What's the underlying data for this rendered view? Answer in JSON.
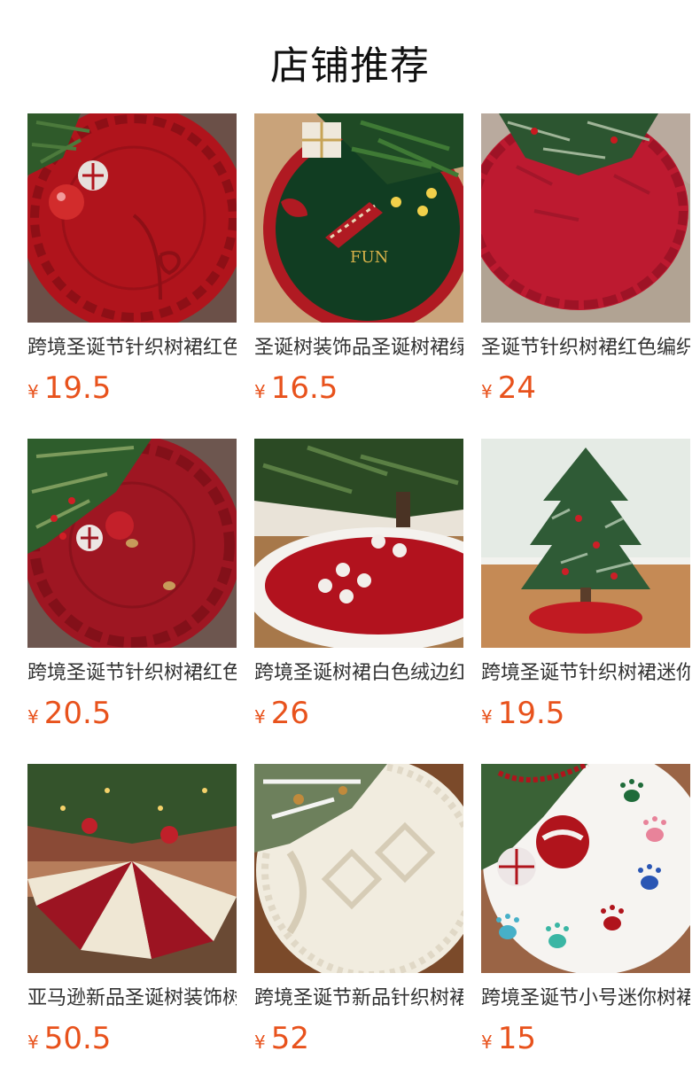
{
  "section": {
    "title": "店铺推荐"
  },
  "currency_symbol": "¥",
  "colors": {
    "price": "#e8521c",
    "title": "#111111",
    "name": "#333333"
  },
  "products": [
    {
      "name": "跨境圣诞节针织树裙红色编织",
      "price": "19.5",
      "image_icon": "red-knit-tree-skirt-with-baubles"
    },
    {
      "name": "圣诞树装饰品圣诞树裙绿色",
      "price": "16.5",
      "image_icon": "green-elf-tree-skirt-fun"
    },
    {
      "name": "圣诞节针织树裙红色编织款",
      "price": "24",
      "image_icon": "red-cable-knit-tree-skirt"
    },
    {
      "name": "跨境圣诞节针织树裙红色纽扣",
      "price": "20.5",
      "image_icon": "red-knit-tree-skirt-buttons"
    },
    {
      "name": "跨境圣诞树裙白色绒边红色",
      "price": "26",
      "image_icon": "red-white-plush-tree-skirt"
    },
    {
      "name": "跨境圣诞节针织树裙迷你",
      "price": "19.5",
      "image_icon": "mini-tree-red-skirt"
    },
    {
      "name": "亚马逊新品圣诞树装饰树裙",
      "price": "50.5",
      "image_icon": "red-cream-striped-tree-skirt"
    },
    {
      "name": "跨境圣诞节新品针织树裙白色",
      "price": "52",
      "image_icon": "white-cable-knit-tree-skirt"
    },
    {
      "name": "跨境圣诞节小号迷你树裙爪印",
      "price": "15",
      "image_icon": "white-paw-print-tree-skirt"
    }
  ]
}
